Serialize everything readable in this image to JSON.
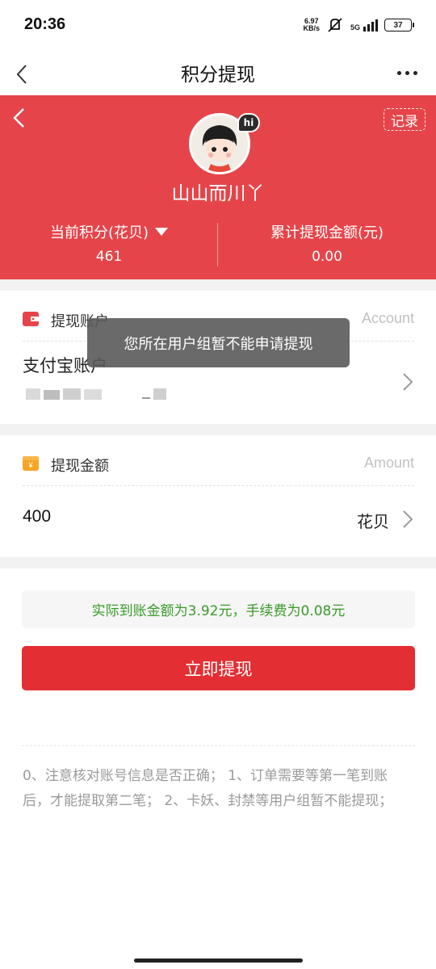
{
  "status_bar": {
    "time": "20:36",
    "net_speed_value": "6.97",
    "net_speed_unit": "KB/s",
    "signal_label": "5G",
    "battery": "37"
  },
  "nav": {
    "title": "积分提现"
  },
  "hero": {
    "record_label": "记录",
    "username": "山山而川丫",
    "avatar_badge": "hi",
    "points_label": "当前积分(花贝)",
    "points_value": "461",
    "total_label": "累计提现金额(元)",
    "total_value": "0.00",
    "accent_color": "#e5454a"
  },
  "account_section": {
    "title": "提现账户",
    "hint": "Account",
    "account_name": "支付宝账户"
  },
  "amount_section": {
    "title": "提现金额",
    "hint": "Amount",
    "value": "400",
    "unit": "花贝"
  },
  "fee_notice": "实际到账金额为3.92元，手续费为0.08元",
  "submit_label": "立即提现",
  "notes": "0、注意核对账号信息是否正确； 1、订单需要等第一笔到账后，才能提取第二笔； 2、卡妖、封禁等用户组暂不能提现；",
  "toast": "您所在用户组暂不能申请提现",
  "colors": {
    "primary_button": "#e32e33",
    "fee_text": "#3a9a2a",
    "icon_account": "#e5454a",
    "icon_amount": "#f5a623"
  }
}
